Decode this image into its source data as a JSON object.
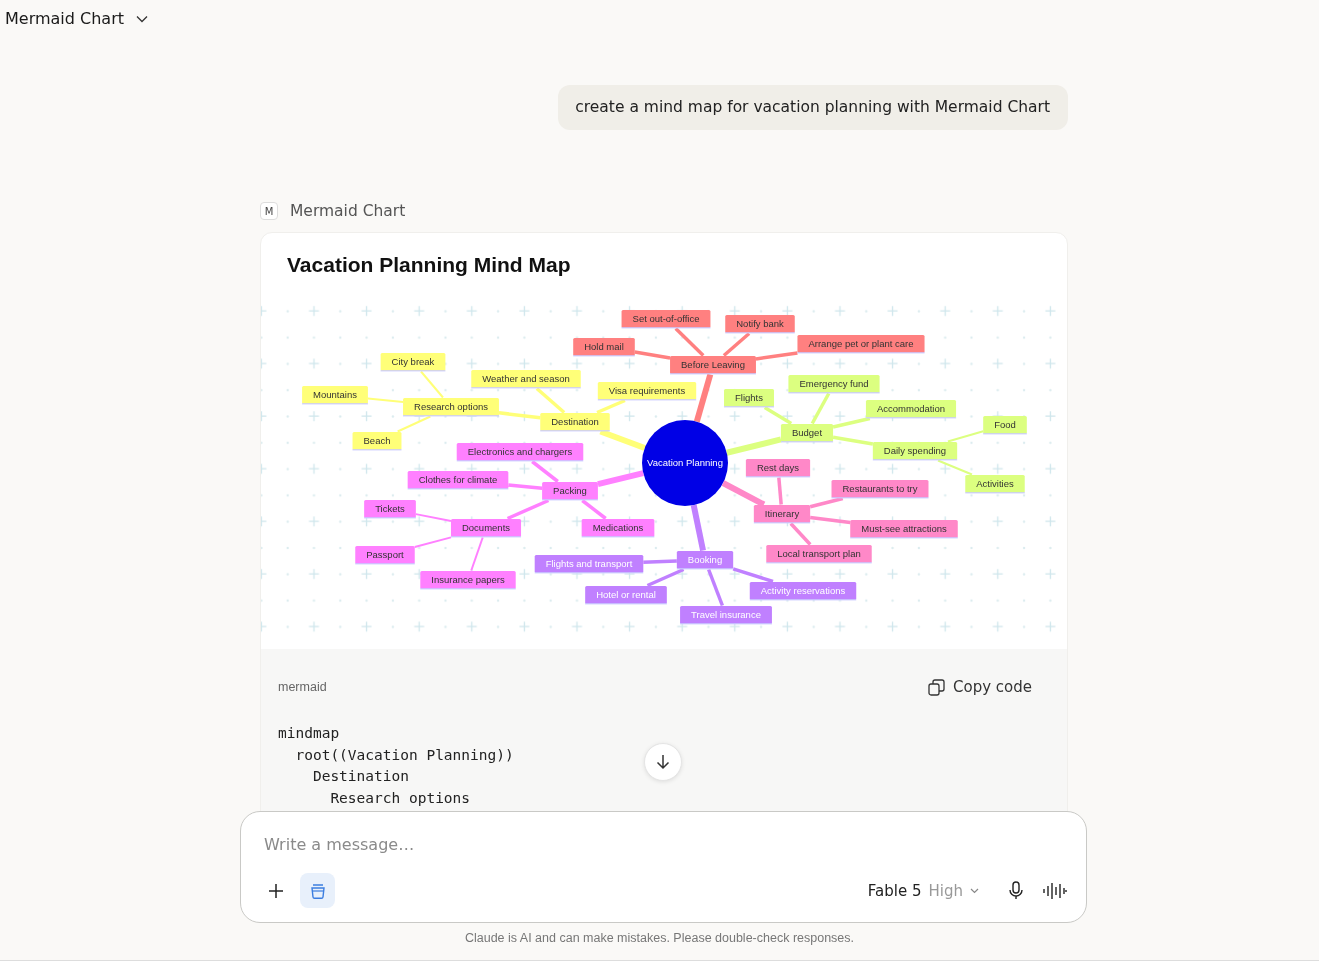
{
  "header": {
    "title": "Mermaid Chart"
  },
  "user_message": {
    "text": "create a mind map for vacation planning with Mermaid Chart"
  },
  "response": {
    "source_icon_letter": "M",
    "source": "Mermaid Chart",
    "diagram": {
      "title": "Vacation Planning Mind Map",
      "root": {
        "label": "Vacation Planning",
        "color": "#0000e6",
        "children": [
          {
            "label": "Destination",
            "color": "#ffff78",
            "children": [
              {
                "label": "Research options",
                "children": [
                  {
                    "label": "City break"
                  },
                  {
                    "label": "Mountains"
                  },
                  {
                    "label": "Beach"
                  }
                ]
              },
              {
                "label": "Weather and season"
              },
              {
                "label": "Visa requirements"
              }
            ]
          },
          {
            "label": "Budget",
            "color": "#dcff80",
            "children": [
              {
                "label": "Flights"
              },
              {
                "label": "Emergency fund"
              },
              {
                "label": "Accommodation"
              },
              {
                "label": "Daily spending",
                "children": [
                  {
                    "label": "Food"
                  },
                  {
                    "label": "Activities"
                  }
                ]
              }
            ]
          },
          {
            "label": "Itinerary",
            "color": "#ff88c8",
            "children": [
              {
                "label": "Rest days"
              },
              {
                "label": "Restaurants to try"
              },
              {
                "label": "Must-see attractions"
              },
              {
                "label": "Local transport plan"
              }
            ]
          },
          {
            "label": "Booking",
            "color": "#c080ff",
            "children": [
              {
                "label": "Flights and transport"
              },
              {
                "label": "Hotel or rental"
              },
              {
                "label": "Travel insurance"
              },
              {
                "label": "Activity reservations"
              }
            ]
          },
          {
            "label": "Packing",
            "color": "#ff80ff",
            "children": [
              {
                "label": "Electronics and chargers"
              },
              {
                "label": "Clothes for climate"
              },
              {
                "label": "Documents",
                "children": [
                  {
                    "label": "Tickets"
                  },
                  {
                    "label": "Passport"
                  },
                  {
                    "label": "Insurance papers"
                  }
                ]
              },
              {
                "label": "Medications"
              }
            ]
          },
          {
            "label": "Before Leaving",
            "color": "#ff8080",
            "children": [
              {
                "label": "Hold mail"
              },
              {
                "label": "Set out-of-office"
              },
              {
                "label": "Notify bank"
              },
              {
                "label": "Arrange pet or plant care"
              }
            ]
          }
        ]
      }
    },
    "code_block": {
      "language": "mermaid",
      "copy_label": "Copy code",
      "lines": [
        "mindmap",
        "  root((Vacation Planning))",
        "    Destination",
        "      Research options"
      ]
    }
  },
  "composer": {
    "placeholder": "Write a message…",
    "model": "Fable 5",
    "effort": "High"
  },
  "disclaimer": "Claude is AI and can make mistakes. Please double-check responses."
}
